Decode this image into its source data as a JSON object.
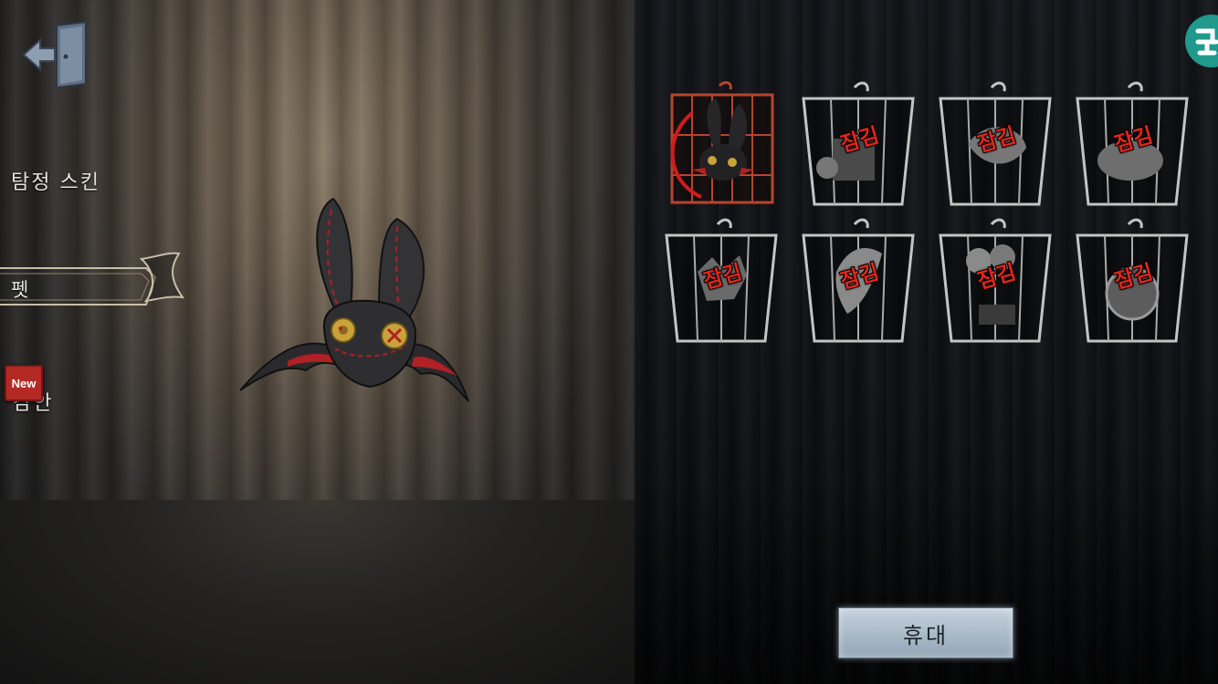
{
  "menu": {
    "skin_label": "탐정 스킨",
    "pet_label": "펫",
    "third_label": "감안",
    "new_badge": "New"
  },
  "cages": [
    {
      "item": "bat-doll",
      "locked": false,
      "selected": true,
      "lock_label": ""
    },
    {
      "item": "gift-box",
      "locked": true,
      "selected": false,
      "lock_label": "잠김"
    },
    {
      "item": "crow",
      "locked": true,
      "selected": false,
      "lock_label": "잠김"
    },
    {
      "item": "rabbit-creature",
      "locked": true,
      "selected": false,
      "lock_label": "잠김"
    },
    {
      "item": "flower-monster",
      "locked": true,
      "selected": false,
      "lock_label": "잠김"
    },
    {
      "item": "moth",
      "locked": true,
      "selected": false,
      "lock_label": "잠김"
    },
    {
      "item": "balloon-box",
      "locked": true,
      "selected": false,
      "lock_label": "잠김"
    },
    {
      "item": "drum-bird",
      "locked": true,
      "selected": false,
      "lock_label": "잠김"
    }
  ],
  "carry_button": "휴대",
  "colors": {
    "lock_text": "#e0261c",
    "selected_cage": "#b5452e",
    "new_badge": "#b32a25",
    "logo": "#1f9a8c",
    "button": "#a9bac7"
  },
  "icons": {
    "exit": "exit-door-icon",
    "logo": "app-logo-icon"
  }
}
